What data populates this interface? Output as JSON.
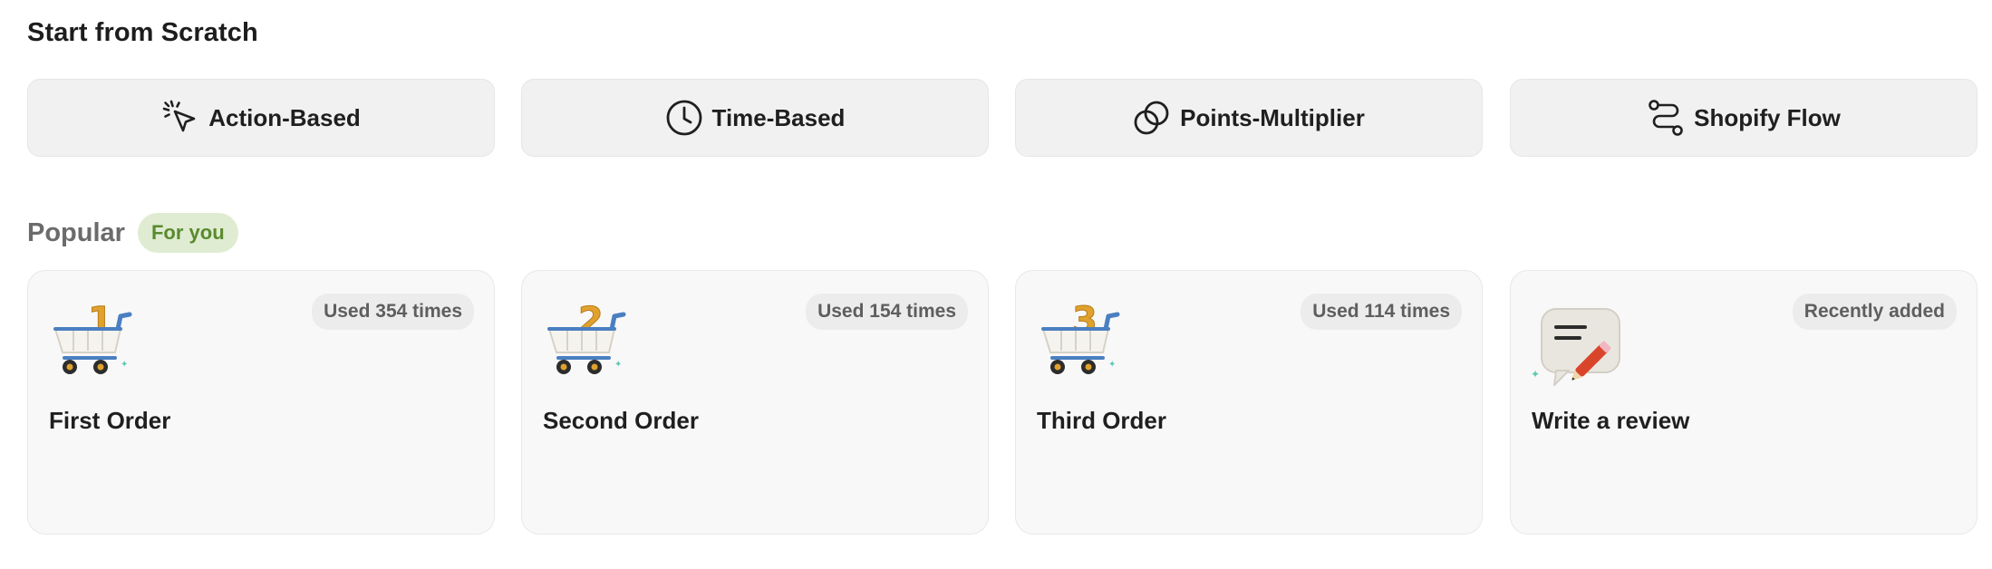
{
  "scratch": {
    "title": "Start from Scratch",
    "buttons": [
      {
        "label": "Action-Based",
        "icon": "cursor-click-icon"
      },
      {
        "label": "Time-Based",
        "icon": "clock-icon"
      },
      {
        "label": "Points-Multiplier",
        "icon": "overlapping-circles-icon"
      },
      {
        "label": "Shopify Flow",
        "icon": "flow-path-icon"
      }
    ]
  },
  "popular": {
    "title": "Popular",
    "badge": "For you",
    "cards": [
      {
        "title": "First Order",
        "usage": "Used 354 times",
        "icon": "cart-number-1-icon"
      },
      {
        "title": "Second Order",
        "usage": "Used 154 times",
        "icon": "cart-number-2-icon"
      },
      {
        "title": "Third Order",
        "usage": "Used 114 times",
        "icon": "cart-number-3-icon"
      },
      {
        "title": "Write a review",
        "usage": "Recently added",
        "icon": "review-bubble-pencil-icon"
      }
    ],
    "cart_numbers": [
      "1",
      "2",
      "3"
    ]
  },
  "colors": {
    "button_bg": "#f1f1f1",
    "card_bg": "#f8f8f8",
    "badge_bg": "#dfecd2",
    "badge_text": "#5a8a2e",
    "cart_number": "#e0a12e",
    "cart_frame": "#4a7fc1",
    "pencil": "#d9452b"
  }
}
